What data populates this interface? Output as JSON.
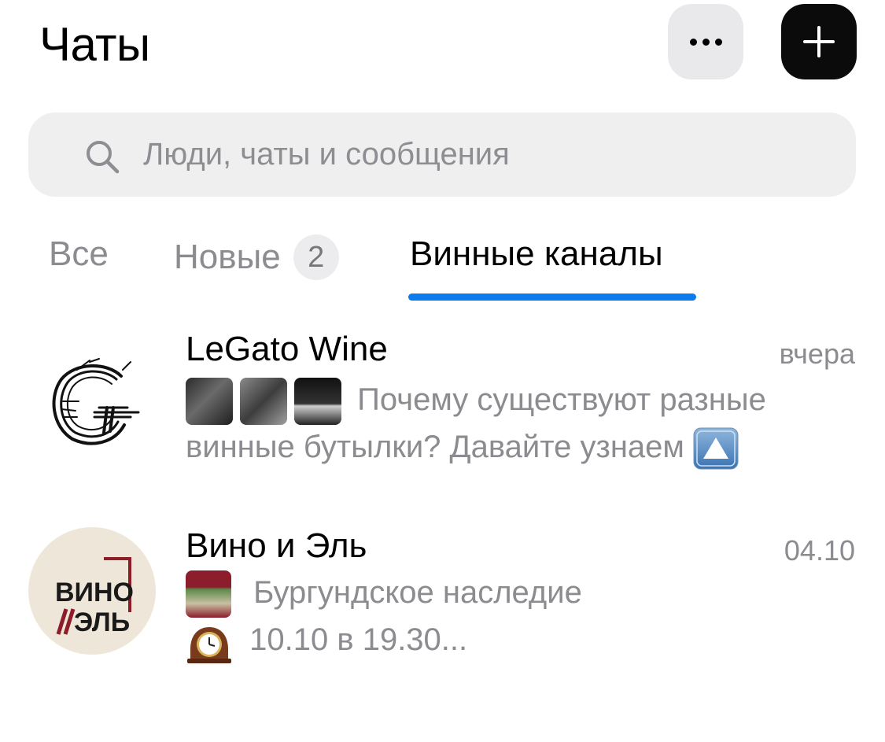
{
  "header": {
    "title": "Чаты"
  },
  "search": {
    "placeholder": "Люди, чаты и сообщения"
  },
  "tabs": [
    {
      "label": "Все",
      "active": false
    },
    {
      "label": "Новые",
      "badge": "2",
      "active": false
    },
    {
      "label": "Винные каналы",
      "active": true
    }
  ],
  "accent_color": "#0a7cf0",
  "chats": [
    {
      "name": "LeGato Wine",
      "time": "вчера",
      "preview_line1": "Почему существуют разные",
      "preview_line2": "винные бутылки? Давайте узнаем",
      "preview_emoji": "up-button-icon"
    },
    {
      "name": "Вино и Эль",
      "time": "04.10",
      "preview_line1": "Бургундское наследие",
      "preview_line2": "10.10 в 19.30...",
      "avatar_text_1": "ВИНО",
      "avatar_text_2": "ЭЛЬ",
      "preview_emoji": "mantelpiece-clock-icon"
    }
  ]
}
